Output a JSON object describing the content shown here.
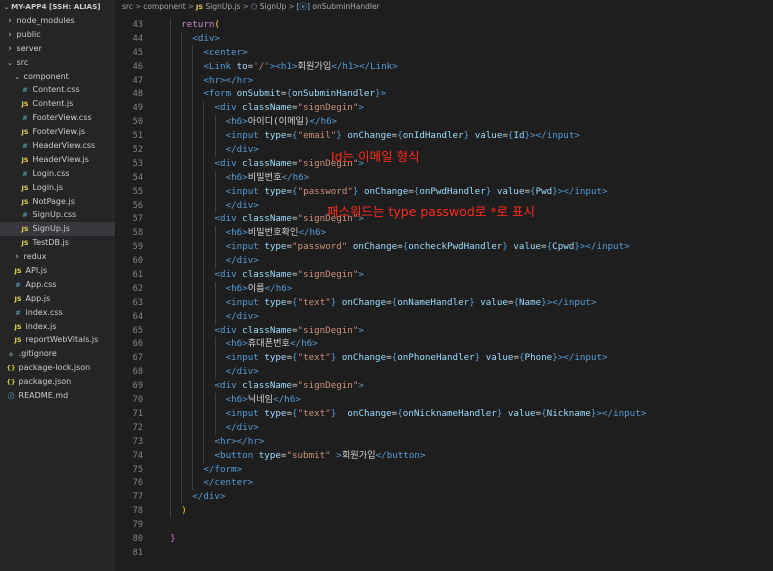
{
  "explorer": {
    "title": "MY-APP4 [SSH: ALIAS]",
    "items": [
      {
        "label": "node_modules",
        "kind": "folder",
        "depth": 0,
        "expanded": false
      },
      {
        "label": "public",
        "kind": "folder",
        "depth": 0,
        "expanded": false
      },
      {
        "label": "server",
        "kind": "folder",
        "depth": 0,
        "expanded": false
      },
      {
        "label": "src",
        "kind": "folder",
        "depth": 0,
        "expanded": true
      },
      {
        "label": "component",
        "kind": "folder",
        "depth": 1,
        "expanded": true
      },
      {
        "label": "Content.css",
        "kind": "css",
        "depth": 2
      },
      {
        "label": "Content.js",
        "kind": "js",
        "depth": 2
      },
      {
        "label": "FooterView.css",
        "kind": "css",
        "depth": 2
      },
      {
        "label": "FooterView.js",
        "kind": "js",
        "depth": 2
      },
      {
        "label": "HeaderView.css",
        "kind": "css",
        "depth": 2
      },
      {
        "label": "HeaderView.js",
        "kind": "js",
        "depth": 2
      },
      {
        "label": "Login.css",
        "kind": "css",
        "depth": 2
      },
      {
        "label": "Login.js",
        "kind": "js",
        "depth": 2
      },
      {
        "label": "NotPage.js",
        "kind": "js",
        "depth": 2
      },
      {
        "label": "SignUp.css",
        "kind": "css",
        "depth": 2
      },
      {
        "label": "SignUp.js",
        "kind": "js",
        "depth": 2,
        "selected": true
      },
      {
        "label": "TestDB.js",
        "kind": "js",
        "depth": 2
      },
      {
        "label": "redux",
        "kind": "folder",
        "depth": 1,
        "expanded": false
      },
      {
        "label": "API.js",
        "kind": "js",
        "depth": 1
      },
      {
        "label": "App.css",
        "kind": "css",
        "depth": 1
      },
      {
        "label": "App.js",
        "kind": "js",
        "depth": 1
      },
      {
        "label": "index.css",
        "kind": "css",
        "depth": 1
      },
      {
        "label": "index.js",
        "kind": "js",
        "depth": 1
      },
      {
        "label": "reportWebVitals.js",
        "kind": "js",
        "depth": 1
      },
      {
        "label": ".gitignore",
        "kind": "git",
        "depth": 0
      },
      {
        "label": "package-lock.json",
        "kind": "json",
        "depth": 0
      },
      {
        "label": "package.json",
        "kind": "json",
        "depth": 0
      },
      {
        "label": "README.md",
        "kind": "info",
        "depth": 0
      }
    ],
    "icon_glyphs": {
      "js": "JS",
      "css": "#",
      "json": "{}",
      "info": "ⓘ",
      "git": "◈"
    },
    "icon_names": {
      "js": "javascript-file-icon",
      "css": "css-file-icon",
      "json": "json-file-icon",
      "info": "readme-info-icon",
      "git": "gitignore-icon"
    }
  },
  "breadcrumb": {
    "folder1": "src",
    "folder2": "component",
    "file_icon": "JS",
    "file": "SignUp.js",
    "component_icon": "⬡",
    "component": "SignUp",
    "method_icon": "[ⓔ]",
    "method": "onSubminHandler",
    "separator": ">"
  },
  "code": {
    "lines": [
      {
        "n": "43",
        "indent": 4,
        "t": [
          [
            "kw",
            "return"
          ],
          [
            "br",
            "("
          ]
        ]
      },
      {
        "n": "44",
        "indent": 6,
        "t": [
          [
            "tag",
            "<div>"
          ]
        ]
      },
      {
        "n": "45",
        "indent": 8,
        "t": [
          [
            "tag",
            "<center>"
          ]
        ]
      },
      {
        "n": "46",
        "indent": 8,
        "t": [
          [
            "tag",
            "<Link "
          ],
          [
            "attr",
            "to"
          ],
          [
            "p",
            "="
          ],
          [
            "str",
            "'/'"
          ],
          [
            "tag",
            ">"
          ],
          [
            "tag",
            "<h1>"
          ],
          [
            "txt",
            "회원가입"
          ],
          [
            "tag",
            "</h1>"
          ],
          [
            "tag",
            "</Link>"
          ]
        ]
      },
      {
        "n": "47",
        "indent": 8,
        "t": [
          [
            "tag",
            "<hr>"
          ],
          [
            "tag",
            "</hr>"
          ]
        ]
      },
      {
        "n": "48",
        "indent": 8,
        "t": [
          [
            "tag",
            "<form "
          ],
          [
            "attr",
            "onSubmit"
          ],
          [
            "p",
            "="
          ],
          [
            "tag",
            "{"
          ],
          [
            "attr",
            "onSubminHandler"
          ],
          [
            "tag",
            "}"
          ],
          [
            "tag",
            ">"
          ]
        ]
      },
      {
        "n": "49",
        "indent": 10,
        "t": [
          [
            "tag",
            "<div "
          ],
          [
            "attr",
            "className"
          ],
          [
            "p",
            "="
          ],
          [
            "str",
            "\"signDegin\""
          ],
          [
            "tag",
            ">"
          ]
        ]
      },
      {
        "n": "50",
        "indent": 12,
        "t": [
          [
            "tag",
            "<h6>"
          ],
          [
            "txt",
            "아이디(이메일)"
          ],
          [
            "tag",
            "</h6>"
          ]
        ]
      },
      {
        "n": "51",
        "indent": 12,
        "t": [
          [
            "tag",
            "<input "
          ],
          [
            "attr",
            "type"
          ],
          [
            "p",
            "="
          ],
          [
            "tag",
            "{"
          ],
          [
            "str",
            "\"email\""
          ],
          [
            "tag",
            "}"
          ],
          [
            "p",
            " "
          ],
          [
            "attr",
            "onChange"
          ],
          [
            "p",
            "="
          ],
          [
            "tag",
            "{"
          ],
          [
            "attr",
            "onIdHandler"
          ],
          [
            "tag",
            "}"
          ],
          [
            "p",
            " "
          ],
          [
            "attr",
            "value"
          ],
          [
            "p",
            "="
          ],
          [
            "tag",
            "{"
          ],
          [
            "attr",
            "Id"
          ],
          [
            "tag",
            "}"
          ],
          [
            "tag",
            "></input>"
          ]
        ]
      },
      {
        "n": "52",
        "indent": 12,
        "t": [
          [
            "tag",
            "</div>"
          ]
        ]
      },
      {
        "n": "53",
        "indent": 10,
        "t": [
          [
            "tag",
            "<div "
          ],
          [
            "attr",
            "className"
          ],
          [
            "p",
            "="
          ],
          [
            "str",
            "\"signDegin\""
          ],
          [
            "tag",
            ">"
          ]
        ]
      },
      {
        "n": "54",
        "indent": 12,
        "t": [
          [
            "tag",
            "<h6>"
          ],
          [
            "txt",
            "비밀번호"
          ],
          [
            "tag",
            "</h6>"
          ]
        ]
      },
      {
        "n": "55",
        "indent": 12,
        "t": [
          [
            "tag",
            "<input "
          ],
          [
            "attr",
            "type"
          ],
          [
            "p",
            "="
          ],
          [
            "tag",
            "{"
          ],
          [
            "str",
            "\"password\""
          ],
          [
            "tag",
            "}"
          ],
          [
            "p",
            " "
          ],
          [
            "attr",
            "onChange"
          ],
          [
            "p",
            "="
          ],
          [
            "tag",
            "{"
          ],
          [
            "attr",
            "onPwdHandler"
          ],
          [
            "tag",
            "}"
          ],
          [
            "p",
            " "
          ],
          [
            "attr",
            "value"
          ],
          [
            "p",
            "="
          ],
          [
            "tag",
            "{"
          ],
          [
            "attr",
            "Pwd"
          ],
          [
            "tag",
            "}"
          ],
          [
            "tag",
            "></input>"
          ]
        ]
      },
      {
        "n": "56",
        "indent": 12,
        "t": [
          [
            "tag",
            "</div>"
          ]
        ]
      },
      {
        "n": "57",
        "indent": 10,
        "t": [
          [
            "tag",
            "<div "
          ],
          [
            "attr",
            "className"
          ],
          [
            "p",
            "="
          ],
          [
            "str",
            "\"signDegin\""
          ],
          [
            "tag",
            ">"
          ]
        ]
      },
      {
        "n": "58",
        "indent": 12,
        "t": [
          [
            "tag",
            "<h6>"
          ],
          [
            "txt",
            "비밀번호확인"
          ],
          [
            "tag",
            "</h6>"
          ]
        ]
      },
      {
        "n": "59",
        "indent": 12,
        "t": [
          [
            "tag",
            "<input "
          ],
          [
            "attr",
            "type"
          ],
          [
            "p",
            "="
          ],
          [
            "str",
            "\"password\""
          ],
          [
            "p",
            " "
          ],
          [
            "attr",
            "onChange"
          ],
          [
            "p",
            "="
          ],
          [
            "tag",
            "{"
          ],
          [
            "attr",
            "oncheckPwdHandler"
          ],
          [
            "tag",
            "}"
          ],
          [
            "p",
            " "
          ],
          [
            "attr",
            "value"
          ],
          [
            "p",
            "="
          ],
          [
            "tag",
            "{"
          ],
          [
            "attr",
            "Cpwd"
          ],
          [
            "tag",
            "}"
          ],
          [
            "tag",
            "></input>"
          ]
        ]
      },
      {
        "n": "60",
        "indent": 12,
        "t": [
          [
            "tag",
            "</div>"
          ]
        ]
      },
      {
        "n": "61",
        "indent": 10,
        "t": [
          [
            "tag",
            "<div "
          ],
          [
            "attr",
            "className"
          ],
          [
            "p",
            "="
          ],
          [
            "str",
            "\"signDegin\""
          ],
          [
            "tag",
            ">"
          ]
        ]
      },
      {
        "n": "62",
        "indent": 12,
        "t": [
          [
            "tag",
            "<h6>"
          ],
          [
            "txt",
            "이름"
          ],
          [
            "tag",
            "</h6>"
          ]
        ]
      },
      {
        "n": "63",
        "indent": 12,
        "t": [
          [
            "tag",
            "<input "
          ],
          [
            "attr",
            "type"
          ],
          [
            "p",
            "="
          ],
          [
            "tag",
            "{"
          ],
          [
            "str",
            "\"text\""
          ],
          [
            "tag",
            "}"
          ],
          [
            "p",
            " "
          ],
          [
            "attr",
            "onChange"
          ],
          [
            "p",
            "="
          ],
          [
            "tag",
            "{"
          ],
          [
            "attr",
            "onNameHandler"
          ],
          [
            "tag",
            "}"
          ],
          [
            "p",
            " "
          ],
          [
            "attr",
            "value"
          ],
          [
            "p",
            "="
          ],
          [
            "tag",
            "{"
          ],
          [
            "attr",
            "Name"
          ],
          [
            "tag",
            "}"
          ],
          [
            "tag",
            "></input>"
          ]
        ]
      },
      {
        "n": "64",
        "indent": 12,
        "t": [
          [
            "tag",
            "</div>"
          ]
        ]
      },
      {
        "n": "65",
        "indent": 10,
        "t": [
          [
            "tag",
            "<div "
          ],
          [
            "attr",
            "className"
          ],
          [
            "p",
            "="
          ],
          [
            "str",
            "\"signDegin\""
          ],
          [
            "tag",
            ">"
          ]
        ]
      },
      {
        "n": "66",
        "indent": 12,
        "t": [
          [
            "tag",
            "<h6>"
          ],
          [
            "txt",
            "휴대폰번호"
          ],
          [
            "tag",
            "</h6>"
          ]
        ]
      },
      {
        "n": "67",
        "indent": 12,
        "t": [
          [
            "tag",
            "<input "
          ],
          [
            "attr",
            "type"
          ],
          [
            "p",
            "="
          ],
          [
            "tag",
            "{"
          ],
          [
            "str",
            "\"text\""
          ],
          [
            "tag",
            "}"
          ],
          [
            "p",
            " "
          ],
          [
            "attr",
            "onChange"
          ],
          [
            "p",
            "="
          ],
          [
            "tag",
            "{"
          ],
          [
            "attr",
            "onPhoneHandler"
          ],
          [
            "tag",
            "}"
          ],
          [
            "p",
            " "
          ],
          [
            "attr",
            "value"
          ],
          [
            "p",
            "="
          ],
          [
            "tag",
            "{"
          ],
          [
            "attr",
            "Phone"
          ],
          [
            "tag",
            "}"
          ],
          [
            "tag",
            "></input>"
          ]
        ]
      },
      {
        "n": "68",
        "indent": 12,
        "t": [
          [
            "tag",
            "</div>"
          ]
        ]
      },
      {
        "n": "69",
        "indent": 10,
        "t": [
          [
            "tag",
            "<div "
          ],
          [
            "attr",
            "className"
          ],
          [
            "p",
            "="
          ],
          [
            "str",
            "\"signDegin\""
          ],
          [
            "tag",
            ">"
          ]
        ]
      },
      {
        "n": "70",
        "indent": 12,
        "t": [
          [
            "tag",
            "<h6>"
          ],
          [
            "txt",
            "닉네임"
          ],
          [
            "tag",
            "</h6>"
          ]
        ]
      },
      {
        "n": "71",
        "indent": 12,
        "t": [
          [
            "tag",
            "<input "
          ],
          [
            "attr",
            "type"
          ],
          [
            "p",
            "="
          ],
          [
            "tag",
            "{"
          ],
          [
            "str",
            "\"text\""
          ],
          [
            "tag",
            "}"
          ],
          [
            "p",
            "  "
          ],
          [
            "attr",
            "onChange"
          ],
          [
            "p",
            "="
          ],
          [
            "tag",
            "{"
          ],
          [
            "attr",
            "onNicknameHandler"
          ],
          [
            "tag",
            "}"
          ],
          [
            "p",
            " "
          ],
          [
            "attr",
            "value"
          ],
          [
            "p",
            "="
          ],
          [
            "tag",
            "{"
          ],
          [
            "attr",
            "Nickname"
          ],
          [
            "tag",
            "}"
          ],
          [
            "tag",
            "></input>"
          ]
        ]
      },
      {
        "n": "72",
        "indent": 12,
        "t": [
          [
            "tag",
            "</div>"
          ]
        ]
      },
      {
        "n": "73",
        "indent": 10,
        "t": [
          [
            "tag",
            "<hr>"
          ],
          [
            "tag",
            "</hr>"
          ]
        ]
      },
      {
        "n": "74",
        "indent": 10,
        "t": [
          [
            "tag",
            "<button "
          ],
          [
            "attr",
            "type"
          ],
          [
            "p",
            "="
          ],
          [
            "str",
            "\"submit\""
          ],
          [
            "p",
            " "
          ],
          [
            "tag",
            ">"
          ],
          [
            "txt",
            "회원가입"
          ],
          [
            "tag",
            "</button>"
          ]
        ]
      },
      {
        "n": "75",
        "indent": 8,
        "t": [
          [
            "tag",
            "</form>"
          ]
        ]
      },
      {
        "n": "76",
        "indent": 8,
        "t": [
          [
            "tag",
            "</center>"
          ]
        ]
      },
      {
        "n": "77",
        "indent": 6,
        "t": [
          [
            "tag",
            "</div>"
          ]
        ]
      },
      {
        "n": "78",
        "indent": 4,
        "t": [
          [
            "br",
            ")"
          ]
        ]
      },
      {
        "n": "79",
        "indent": 0,
        "t": []
      },
      {
        "n": "80",
        "indent": 2,
        "t": [
          [
            "br2",
            "}"
          ]
        ]
      },
      {
        "n": "81",
        "indent": 0,
        "t": []
      }
    ]
  },
  "annotations": {
    "id_note": "Id는 이메일 형식",
    "pw_note": "패스워드는 type passwod로 *로 표시"
  },
  "colors": {
    "editor_bg": "#1e1e1e",
    "sidebar_bg": "#252526",
    "annotation_red": "#ff2a1a",
    "keyword": "#c586c0",
    "tag": "#569cd6",
    "attribute": "#9cdcfe",
    "string": "#ce9178"
  }
}
